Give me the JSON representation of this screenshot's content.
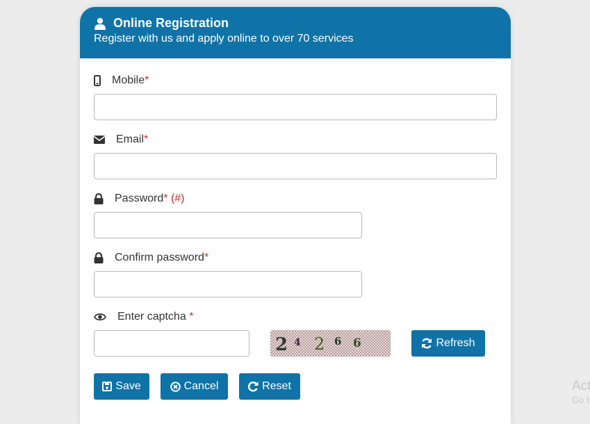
{
  "header": {
    "title": "Online Registration",
    "subtitle": "Register with us and apply online to over 70 services",
    "icon": "user-icon"
  },
  "fields": {
    "mobile": {
      "label": "Mobile",
      "required": "*",
      "icon": "mobile-icon",
      "value": ""
    },
    "email": {
      "label": "Email",
      "required": "*",
      "icon": "envelope-icon",
      "value": ""
    },
    "password": {
      "label": "Password",
      "required": "*",
      "note": "(#)",
      "icon": "lock-icon",
      "value": ""
    },
    "confirm_password": {
      "label": "Confirm password",
      "required": "*",
      "icon": "lock-icon",
      "value": ""
    },
    "captcha": {
      "label": "Enter captcha",
      "required": "*",
      "icon": "eye-icon",
      "value": ""
    }
  },
  "captcha_image": {
    "digits": [
      "2",
      "4",
      "2",
      "6",
      "6"
    ]
  },
  "buttons": {
    "refresh": "Refresh",
    "save": "Save",
    "cancel": "Cancel",
    "reset": "Reset"
  },
  "colors": {
    "primary": "#0f73a8",
    "required": "#c9302c"
  },
  "watermark": {
    "line1": "Act",
    "line2": "Go t"
  }
}
